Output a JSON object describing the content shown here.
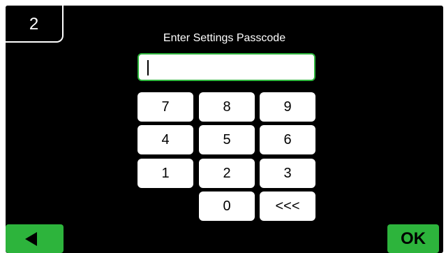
{
  "tab_number": "2",
  "title": "Enter Settings Passcode",
  "passcode_value": "",
  "keypad": {
    "k7": "7",
    "k8": "8",
    "k9": "9",
    "k4": "4",
    "k5": "5",
    "k6": "6",
    "k1": "1",
    "k2": "2",
    "k3": "3",
    "k0": "0",
    "backspace": "<<<"
  },
  "buttons": {
    "back_icon": "left-arrow-icon",
    "ok_label": "OK"
  },
  "colors": {
    "background": "#000000",
    "accent": "#2db43c",
    "keys": "#ffffff"
  }
}
